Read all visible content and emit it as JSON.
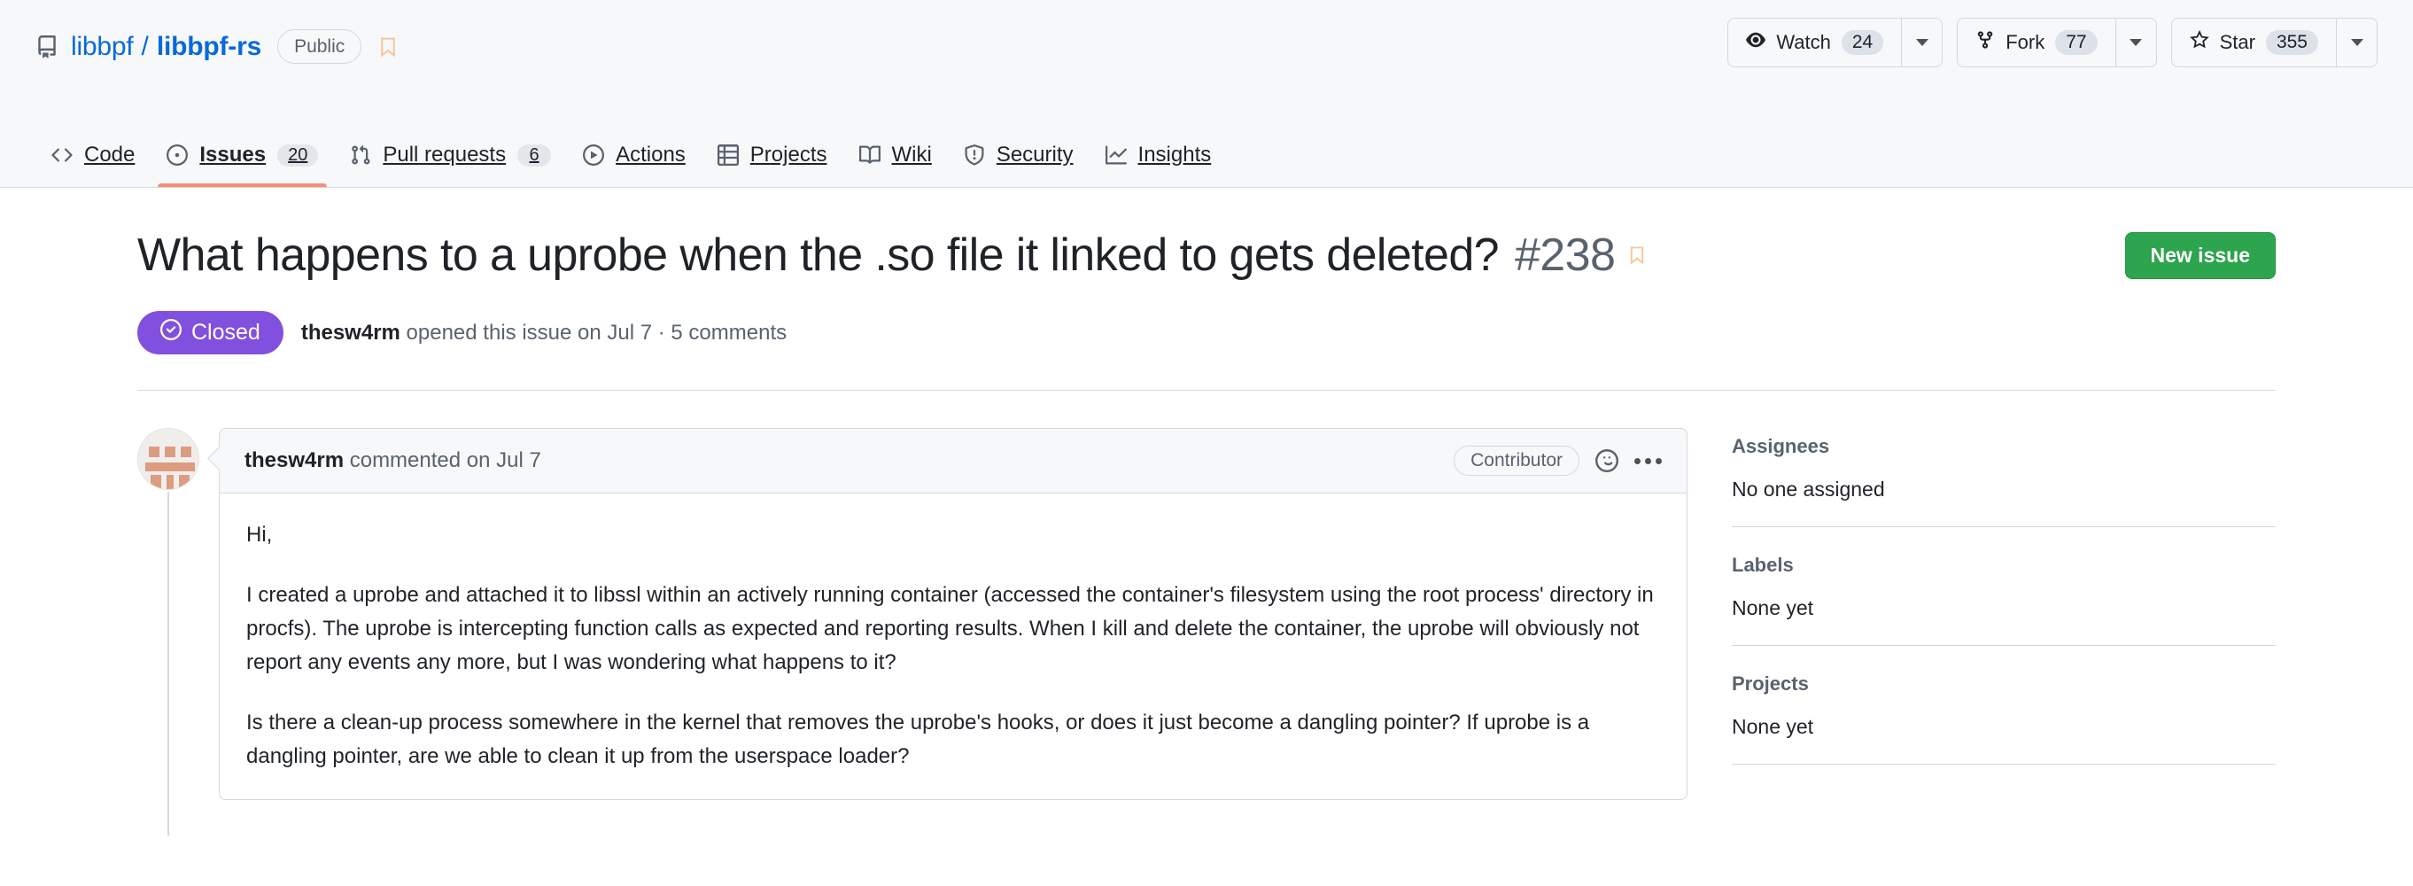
{
  "repo": {
    "owner": "libbpf",
    "separator": "/",
    "name": "libbpf-rs",
    "visibility": "Public",
    "repo_icon": "repo-icon",
    "bookmark_icon": "bookmark-icon"
  },
  "repo_actions": [
    {
      "label": "Watch",
      "count": "24",
      "icon": "eye-icon"
    },
    {
      "label": "Fork",
      "count": "77",
      "icon": "fork-icon"
    },
    {
      "label": "Star",
      "count": "355",
      "icon": "star-icon"
    }
  ],
  "nav": {
    "tabs": [
      {
        "label": "Code",
        "count": "",
        "icon": "code-icon",
        "active": false
      },
      {
        "label": "Issues",
        "count": "20",
        "icon": "issue-opened-icon",
        "active": true
      },
      {
        "label": "Pull requests",
        "count": "6",
        "icon": "git-pull-request-icon",
        "active": false
      },
      {
        "label": "Actions",
        "count": "",
        "icon": "play-icon",
        "active": false
      },
      {
        "label": "Projects",
        "count": "",
        "icon": "table-icon",
        "active": false
      },
      {
        "label": "Wiki",
        "count": "",
        "icon": "book-icon",
        "active": false
      },
      {
        "label": "Security",
        "count": "",
        "icon": "shield-icon",
        "active": false
      },
      {
        "label": "Insights",
        "count": "",
        "icon": "graph-icon",
        "active": false
      }
    ]
  },
  "issue": {
    "title": "What happens to a uprobe when the .so file it linked to gets deleted?",
    "number": "#238",
    "bookmark_icon": "bookmark-icon",
    "new_issue_label": "New issue",
    "state": "Closed",
    "state_icon": "issue-closed-icon",
    "state_color": "#8250df",
    "meta_author": "thesw4rm",
    "meta_rest": " opened this issue on Jul 7 · 5 comments"
  },
  "comment": {
    "author": "thesw4rm",
    "action": " commented on Jul 7",
    "association": "Contributor",
    "reaction_icon": "smiley-icon",
    "menu_icon": "kebab-horizontal-icon",
    "paragraphs": [
      "Hi,",
      "I created a uprobe and attached it to libssl within an actively running container (accessed the container's filesystem using the root process' directory in procfs). The uprobe is intercepting function calls as expected and reporting results. When I kill and delete the container, the uprobe will obviously not report any events any more, but I was wondering what happens to it?",
      "Is there a clean-up process somewhere in the kernel that removes the uprobe's hooks, or does it just become a dangling pointer? If uprobe is a dangling pointer, are we able to clean it up from the userspace loader?"
    ]
  },
  "sidebar": {
    "sections": [
      {
        "title": "Assignees",
        "value": "No one assigned"
      },
      {
        "title": "Labels",
        "value": "None yet"
      },
      {
        "title": "Projects",
        "value": "None yet"
      }
    ]
  },
  "colors": {
    "accent_blue": "#0969da",
    "green_button": "#2da44e",
    "closed_purple": "#8250df",
    "active_tab_underline": "#fd8c73",
    "header_bg": "#f6f8fa",
    "border": "#d1d9e0"
  }
}
